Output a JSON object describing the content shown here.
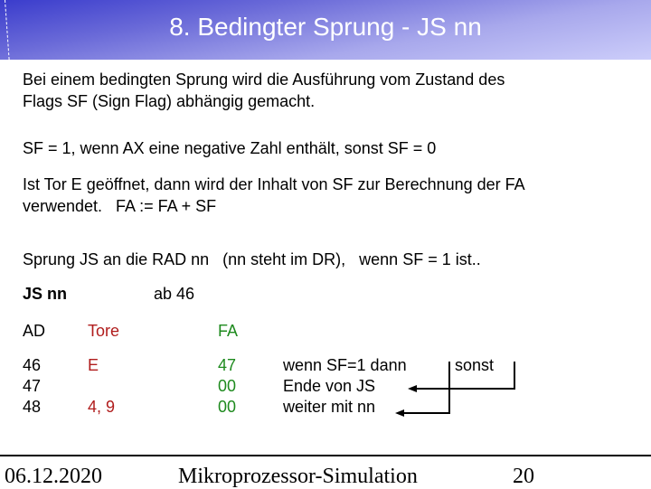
{
  "title": "8. Bedingter Sprung  -  JS nn",
  "paragraphs": {
    "intro_line1": "Bei einem bedingten Sprung wird die Ausführung vom Zustand des",
    "intro_line2": "Flags SF (Sign Flag) abhängig gemacht.",
    "sf_rule": "SF = 1, wenn AX eine negative Zahl enthält, sonst SF = 0",
    "tor_line1": "Ist Tor E geöffnet, dann wird der Inhalt von SF zur Berechnung der FA",
    "tor_line2": "verwendet.   FA := FA + SF",
    "jump_rule": "Sprung JS an die RAD nn   (nn steht im DR),   wenn SF = 1 ist.."
  },
  "command": {
    "name": "JS nn",
    "start": "ab 46"
  },
  "table": {
    "headers": {
      "ad": "AD",
      "tore": "Tore",
      "fa": "FA"
    },
    "rows": [
      {
        "ad": "46",
        "tore": "E",
        "fa": "47",
        "note": "wenn SF=1 dann"
      },
      {
        "ad": "47",
        "tore": "",
        "fa": "00",
        "note": "Ende von JS"
      },
      {
        "ad": "48",
        "tore": "4, 9",
        "fa": "00",
        "note": "weiter mit nn"
      }
    ],
    "else_label": "sonst"
  },
  "colors": {
    "tore": "#b01c1c",
    "fa": "#1e8a1e"
  },
  "footer": {
    "date": "06.12.2020",
    "title": "Mikroprozessor-Simulation",
    "page": "20"
  }
}
